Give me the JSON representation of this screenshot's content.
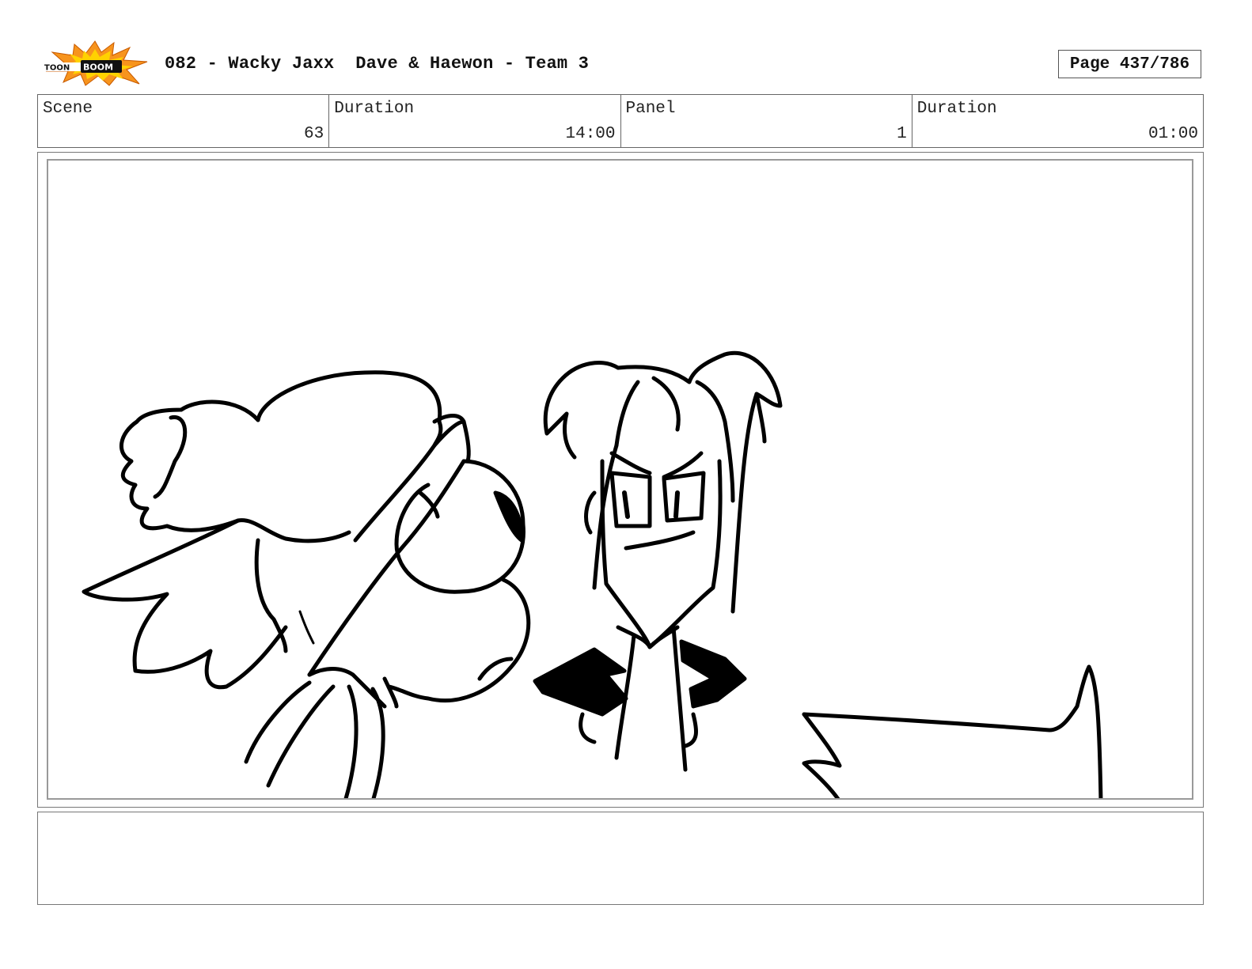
{
  "header": {
    "logo_icon": "toon-boom-logo",
    "logo_text": "TOON BOOM",
    "title": "082 - Wacky Jaxx  Dave & Haewon - Team 3",
    "page": "Page 437/786"
  },
  "info": {
    "scene_label": "Scene",
    "scene_value": "63",
    "scene_duration_label": "Duration",
    "scene_duration_value": "14:00",
    "panel_label": "Panel",
    "panel_value": "1",
    "panel_duration_label": "Duration",
    "panel_duration_value": "01:00"
  },
  "panel": {
    "image": "storyboard-sketch",
    "notes": ""
  },
  "colors": {
    "logo_orange": "#f7941d",
    "logo_yellow": "#ffd200",
    "frame_border": "#777777",
    "ink": "#000000"
  }
}
